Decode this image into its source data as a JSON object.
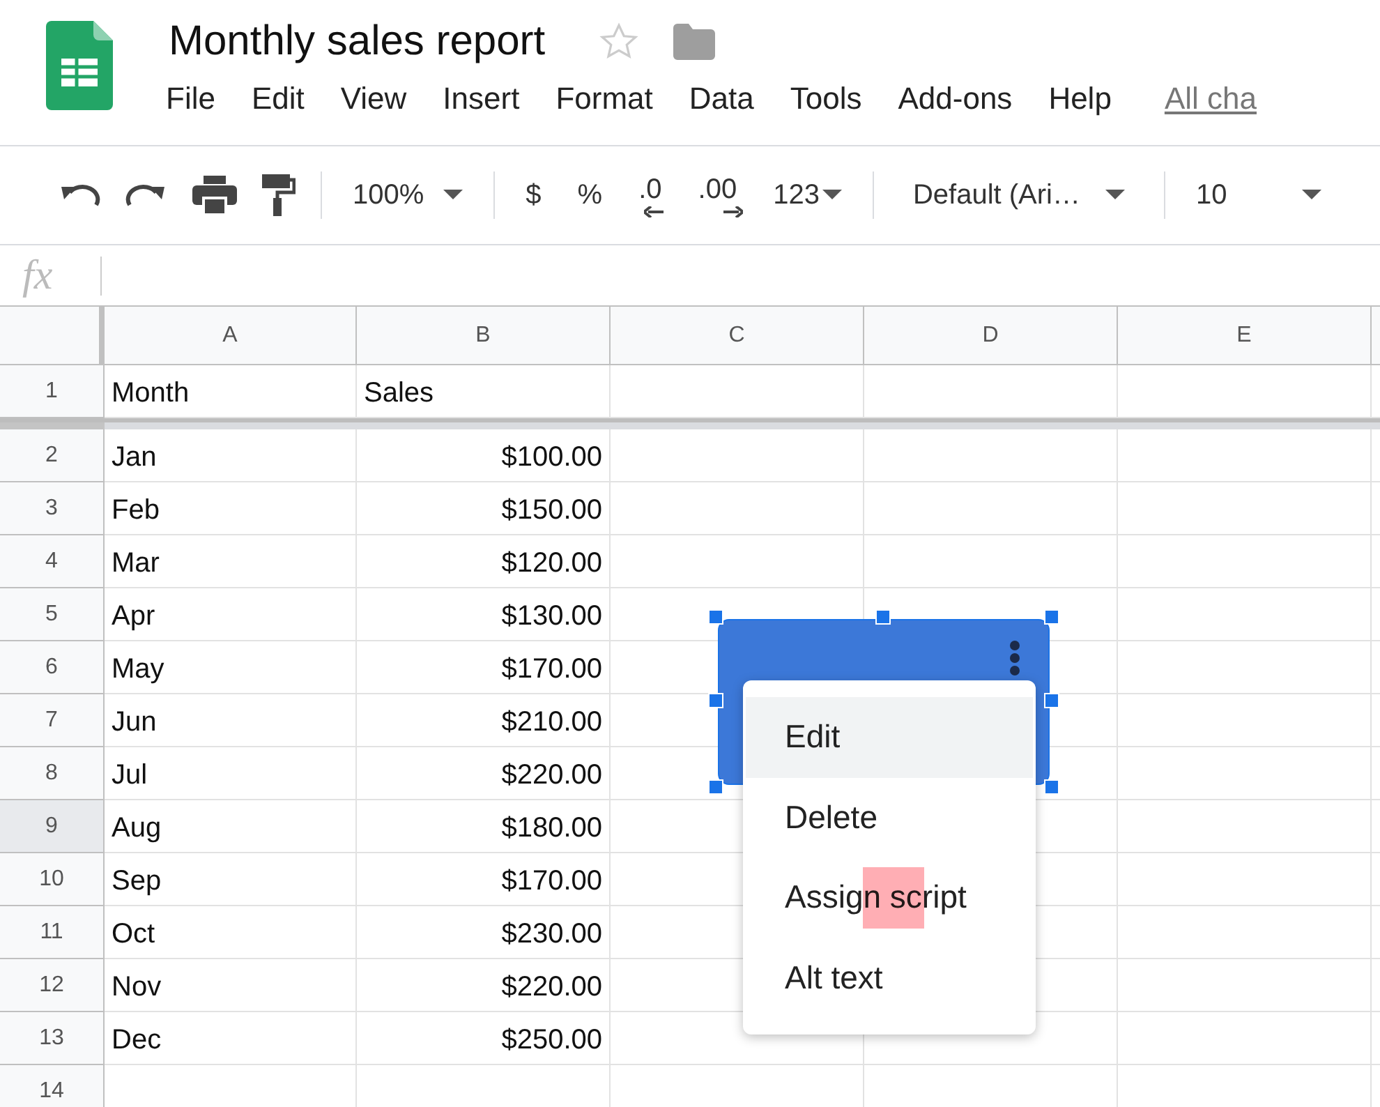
{
  "document": {
    "title": "Monthly sales report",
    "starred": false
  },
  "menu": [
    "File",
    "Edit",
    "View",
    "Insert",
    "Format",
    "Data",
    "Tools",
    "Add-ons",
    "Help"
  ],
  "last_edit_link": "All cha",
  "toolbar": {
    "zoom": "100%",
    "currency": "$",
    "percent": "%",
    "decrease_decimals": ".0",
    "increase_decimals": ".00",
    "more_formats": "123",
    "font": "Default (Ari…",
    "font_size": "10"
  },
  "formula_bar": {
    "label": "fx"
  },
  "columns": [
    "A",
    "B",
    "C",
    "D",
    "E"
  ],
  "rows": [
    {
      "number": "1",
      "kind": "header",
      "month": "Month",
      "sales": "Sales",
      "selected": false
    },
    {
      "number": "2",
      "kind": "data",
      "month": "Jan",
      "sales": "$100.00",
      "selected": false
    },
    {
      "number": "3",
      "kind": "data",
      "month": "Feb",
      "sales": "$150.00",
      "selected": false
    },
    {
      "number": "4",
      "kind": "data",
      "month": "Mar",
      "sales": "$120.00",
      "selected": false
    },
    {
      "number": "5",
      "kind": "data",
      "month": "Apr",
      "sales": "$130.00",
      "selected": false
    },
    {
      "number": "6",
      "kind": "data",
      "month": "May",
      "sales": "$170.00",
      "selected": false
    },
    {
      "number": "7",
      "kind": "data",
      "month": "Jun",
      "sales": "$210.00",
      "selected": false
    },
    {
      "number": "8",
      "kind": "data",
      "month": "Jul",
      "sales": "$220.00",
      "selected": false
    },
    {
      "number": "9",
      "kind": "data",
      "month": "Aug",
      "sales": "$180.00",
      "selected": true
    },
    {
      "number": "10",
      "kind": "data",
      "month": "Sep",
      "sales": "$170.00",
      "selected": false
    },
    {
      "number": "11",
      "kind": "data",
      "month": "Oct",
      "sales": "$230.00",
      "selected": false
    },
    {
      "number": "12",
      "kind": "data",
      "month": "Nov",
      "sales": "$220.00",
      "selected": false
    },
    {
      "number": "13",
      "kind": "data",
      "month": "Dec",
      "sales": "$250.00",
      "selected": false
    },
    {
      "number": "14",
      "kind": "data",
      "selected": false
    }
  ],
  "drawing": {
    "selected": true
  },
  "context_menu": {
    "items": [
      {
        "label": "Edit",
        "selected": true
      },
      {
        "label": "Delete",
        "selected": false
      },
      {
        "label": "Assign script",
        "selected": false
      },
      {
        "label": "Alt text",
        "selected": false
      }
    ]
  }
}
